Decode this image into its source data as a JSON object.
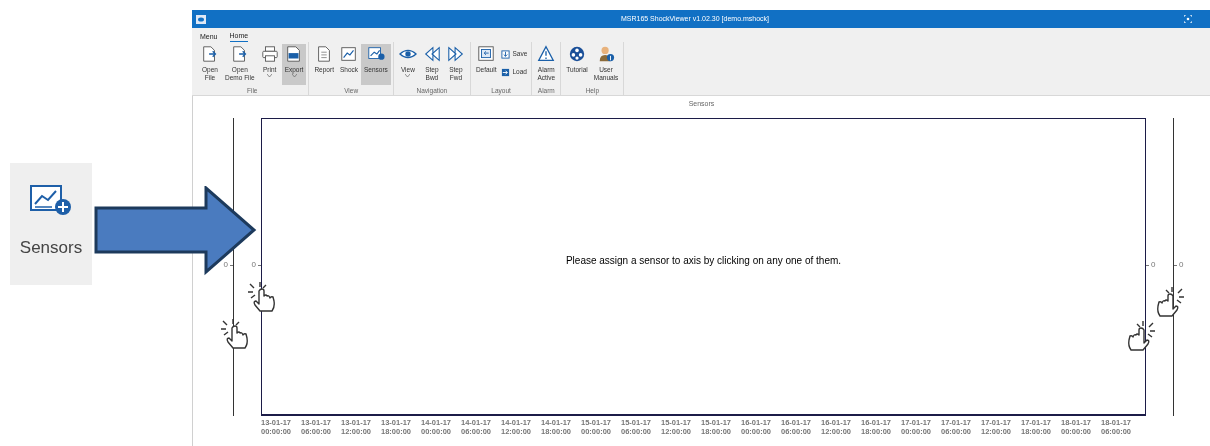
{
  "callout": {
    "label": "Sensors"
  },
  "window": {
    "title": "MSR165 ShockViewer v1.02.30 [demo.mshock]"
  },
  "menu_tabs": [
    {
      "label": "Menu",
      "selected": false
    },
    {
      "label": "Home",
      "selected": true
    }
  ],
  "ribbon_groups": [
    {
      "label": "File",
      "items": [
        {
          "kind": "large",
          "label": "Open\nFile",
          "selected": false,
          "dropdown": false
        },
        {
          "kind": "large",
          "label": "Open\nDemo File",
          "selected": false,
          "dropdown": false
        },
        {
          "kind": "large",
          "label": "Print",
          "selected": false,
          "dropdown": true
        },
        {
          "kind": "large",
          "label": "Export",
          "selected": true,
          "dropdown": true
        }
      ]
    },
    {
      "label": "View",
      "items": [
        {
          "kind": "large",
          "label": "Report",
          "selected": false,
          "dropdown": false
        },
        {
          "kind": "large",
          "label": "Shock",
          "selected": false,
          "dropdown": false
        },
        {
          "kind": "large",
          "label": "Sensors",
          "selected": true,
          "dropdown": false
        }
      ]
    },
    {
      "label": "Navigation",
      "items": [
        {
          "kind": "large",
          "label": "View",
          "selected": false,
          "dropdown": true
        },
        {
          "kind": "large",
          "label": "Step\nBwd",
          "selected": false,
          "dropdown": false
        },
        {
          "kind": "large",
          "label": "Step\nFwd",
          "selected": false,
          "dropdown": false
        }
      ]
    },
    {
      "label": "Layout",
      "items": [
        {
          "kind": "large",
          "label": "Default",
          "selected": false,
          "dropdown": false
        },
        {
          "kind": "small",
          "label": "Save",
          "selected": false
        },
        {
          "kind": "small",
          "label": "Load",
          "selected": false
        }
      ]
    },
    {
      "label": "Alarm",
      "items": [
        {
          "kind": "large",
          "label": "Alarm\nActive",
          "selected": false,
          "dropdown": false
        }
      ]
    },
    {
      "label": "Help",
      "items": [
        {
          "kind": "large",
          "label": "Tutorial",
          "selected": false,
          "dropdown": false
        },
        {
          "kind": "large",
          "label": "User\nManuals",
          "selected": false,
          "dropdown": false
        }
      ]
    }
  ],
  "panel": {
    "title": "Sensors",
    "message": "Please assign a sensor to axis by clicking on any one of them.",
    "left_axis_ticks": [
      "0",
      "0"
    ],
    "right_axis_ticks": [
      "0",
      "0"
    ],
    "x_labels": [
      {
        "date": "13-01-17",
        "time": "00:00:00"
      },
      {
        "date": "13-01-17",
        "time": "06:00:00"
      },
      {
        "date": "13-01-17",
        "time": "12:00:00"
      },
      {
        "date": "13-01-17",
        "time": "18:00:00"
      },
      {
        "date": "14-01-17",
        "time": "00:00:00"
      },
      {
        "date": "14-01-17",
        "time": "06:00:00"
      },
      {
        "date": "14-01-17",
        "time": "12:00:00"
      },
      {
        "date": "14-01-17",
        "time": "18:00:00"
      },
      {
        "date": "15-01-17",
        "time": "00:00:00"
      },
      {
        "date": "15-01-17",
        "time": "06:00:00"
      },
      {
        "date": "15-01-17",
        "time": "12:00:00"
      },
      {
        "date": "15-01-17",
        "time": "18:00:00"
      },
      {
        "date": "16-01-17",
        "time": "00:00:00"
      },
      {
        "date": "16-01-17",
        "time": "06:00:00"
      },
      {
        "date": "16-01-17",
        "time": "12:00:00"
      },
      {
        "date": "16-01-17",
        "time": "18:00:00"
      },
      {
        "date": "17-01-17",
        "time": "00:00:00"
      },
      {
        "date": "17-01-17",
        "time": "06:00:00"
      },
      {
        "date": "17-01-17",
        "time": "12:00:00"
      },
      {
        "date": "17-01-17",
        "time": "18:00:00"
      },
      {
        "date": "18-01-17",
        "time": "00:00:00"
      },
      {
        "date": "18-01-17",
        "time": "06:00:00"
      }
    ]
  }
}
